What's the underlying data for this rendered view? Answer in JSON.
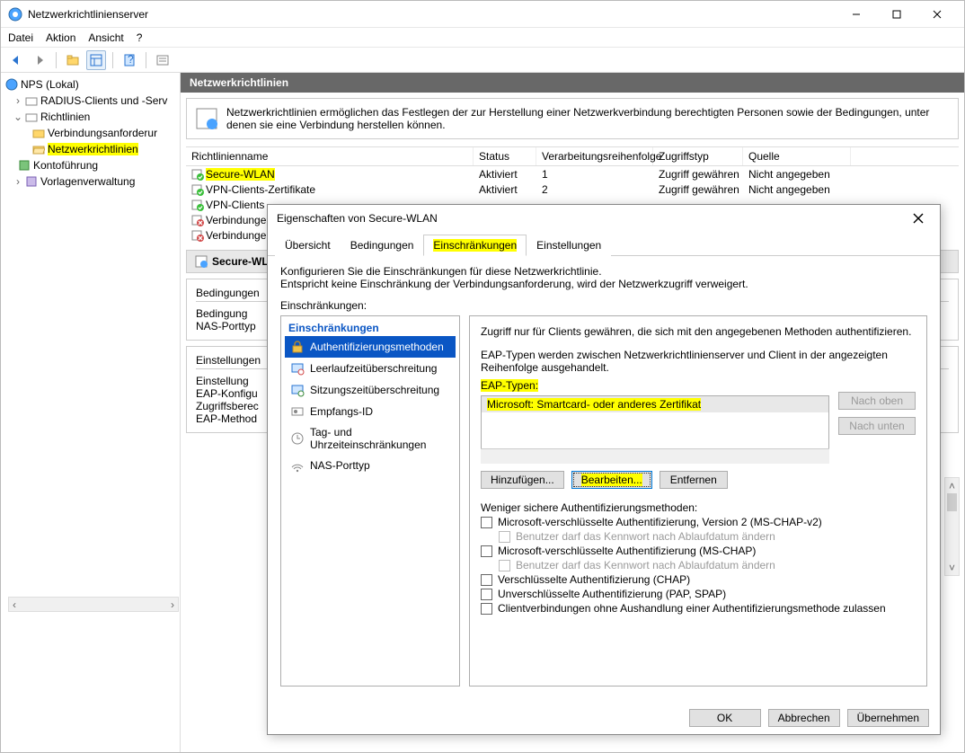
{
  "window": {
    "title": "Netzwerkrichtlinienserver",
    "menu": [
      "Datei",
      "Aktion",
      "Ansicht",
      "?"
    ]
  },
  "tree": {
    "root": "NPS (Lokal)",
    "items": [
      "RADIUS-Clients und -Serv",
      "Richtlinien",
      "Verbindungsanforderur",
      "Netzwerkrichtlinien",
      "Kontoführung",
      "Vorlagenverwaltung"
    ]
  },
  "panel": {
    "title": "Netzwerkrichtlinien",
    "desc": "Netzwerkrichtlinien ermöglichen das Festlegen der zur Herstellung einer Netzwerkverbindung berechtigten Personen sowie der Bedingungen, unter denen sie eine Verbindung herstellen können.",
    "columns": [
      "Richtlinienname",
      "Status",
      "Verarbeitungsreihenfolge",
      "Zugriffstyp",
      "Quelle"
    ],
    "rows": [
      {
        "name": "Secure-WLAN",
        "status": "Aktiviert",
        "order": "1",
        "access": "Zugriff gewähren",
        "source": "Nicht angegeben",
        "hl": true,
        "good": true
      },
      {
        "name": "VPN-Clients-Zertifikate",
        "status": "Aktiviert",
        "order": "2",
        "access": "Zugriff gewähren",
        "source": "Nicht angegeben",
        "good": true
      },
      {
        "name": "VPN-Clients",
        "good": true
      },
      {
        "name": "Verbindunge",
        "good": false
      },
      {
        "name": "Verbindunge",
        "good": false
      }
    ],
    "sub_header": "Secure-WL",
    "cond_title": "Bedingungen",
    "cond_labels": [
      "Bedingung",
      "NAS-Porttyp"
    ],
    "set_title": "Einstellungen",
    "set_labels": [
      "Einstellung",
      "EAP-Konfigu",
      "Zugriffsberec",
      "EAP-Method"
    ]
  },
  "dialog": {
    "title": "Eigenschaften von Secure-WLAN",
    "tabs": [
      "Übersicht",
      "Bedingungen",
      "Einschränkungen",
      "Einstellungen"
    ],
    "active_tab": 2,
    "desc_lines": [
      "Konfigurieren Sie die Einschränkungen für diese Netzwerkrichtlinie.",
      "Entspricht keine Einschränkung der Verbindungsanforderung, wird der Netzwerkzugriff verweigert."
    ],
    "constraints_label": "Einschränkungen:",
    "left_header": "Einschränkungen",
    "left_items": [
      {
        "label": "Authentifizierungsmethoden",
        "icon": "lock",
        "sel": true
      },
      {
        "label": "Leerlaufzeitüberschreitung",
        "icon": "idle"
      },
      {
        "label": "Sitzungszeitüberschreitung",
        "icon": "session"
      },
      {
        "label": "Empfangs-ID",
        "icon": "id"
      },
      {
        "label": "Tag- und Uhrzeiteinschränkungen",
        "icon": "clock"
      },
      {
        "label": "NAS-Porttyp",
        "icon": "wifi"
      }
    ],
    "right": {
      "line1": "Zugriff nur für Clients gewähren, die sich mit den angegebenen Methoden authentifizieren.",
      "line2": "EAP-Typen werden zwischen Netzwerkrichtlinienserver und Client in der angezeigten Reihenfolge ausgehandelt.",
      "eap_label": "EAP-Typen:",
      "eap_items": [
        "Microsoft: Smartcard- oder anderes Zertifikat"
      ],
      "btn_up": "Nach oben",
      "btn_down": "Nach unten",
      "btn_add": "Hinzufügen...",
      "btn_edit": "Bearbeiten...",
      "btn_remove": "Entfernen",
      "less_secure": "Weniger sichere Authentifizierungsmethoden:",
      "chk": [
        "Microsoft-verschlüsselte Authentifizierung, Version 2 (MS-CHAP-v2)",
        "Benutzer darf das Kennwort nach Ablaufdatum ändern",
        "Microsoft-verschlüsselte Authentifizierung (MS-CHAP)",
        "Benutzer darf das Kennwort nach Ablaufdatum ändern",
        "Verschlüsselte Authentifizierung (CHAP)",
        "Unverschlüsselte Authentifizierung (PAP, SPAP)",
        "Clientverbindungen ohne Aushandlung einer Authentifizierungsmethode zulassen"
      ]
    },
    "footer": {
      "ok": "OK",
      "cancel": "Abbrechen",
      "apply": "Übernehmen"
    }
  }
}
